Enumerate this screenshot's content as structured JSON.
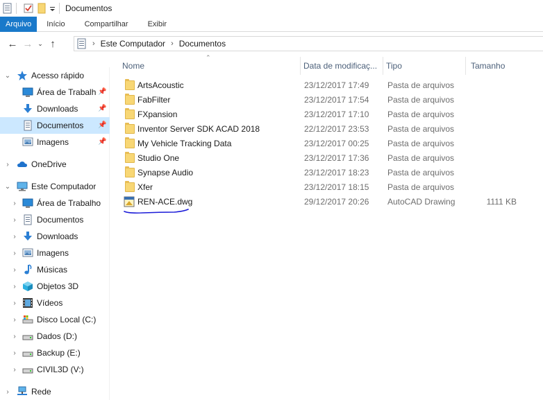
{
  "window": {
    "title": "Documentos"
  },
  "ribbon": {
    "tabs": [
      {
        "label": "Arquivo",
        "active": true
      },
      {
        "label": "Início",
        "active": false
      },
      {
        "label": "Compartilhar",
        "active": false
      },
      {
        "label": "Exibir",
        "active": false
      }
    ]
  },
  "address": {
    "crumbs": [
      "Este Computador",
      "Documentos"
    ]
  },
  "nav": {
    "quick_access": {
      "label": "Acesso rápido",
      "items": [
        {
          "label": "Área de Trabalho",
          "icon": "desktop-icon",
          "pinned": true
        },
        {
          "label": "Downloads",
          "icon": "downloads-icon",
          "pinned": true
        },
        {
          "label": "Documentos",
          "icon": "documents-icon",
          "pinned": true,
          "selected": true
        },
        {
          "label": "Imagens",
          "icon": "pictures-icon",
          "pinned": true
        }
      ]
    },
    "onedrive": {
      "label": "OneDrive"
    },
    "this_pc": {
      "label": "Este Computador",
      "items": [
        {
          "label": "Área de Trabalho",
          "icon": "desktop-icon"
        },
        {
          "label": "Documentos",
          "icon": "documents-icon"
        },
        {
          "label": "Downloads",
          "icon": "downloads-icon"
        },
        {
          "label": "Imagens",
          "icon": "pictures-icon"
        },
        {
          "label": "Músicas",
          "icon": "music-icon"
        },
        {
          "label": "Objetos 3D",
          "icon": "objects-3d-icon"
        },
        {
          "label": "Vídeos",
          "icon": "videos-icon"
        },
        {
          "label": "Disco Local (C:)",
          "icon": "local-disk-icon"
        },
        {
          "label": "Dados (D:)",
          "icon": "drive-icon"
        },
        {
          "label": "Backup (E:)",
          "icon": "drive-icon"
        },
        {
          "label": "CIVIL3D (V:)",
          "icon": "drive-icon"
        }
      ]
    },
    "network": {
      "label": "Rede"
    }
  },
  "columns": {
    "name": "Nome",
    "date": "Data de modificaç...",
    "type": "Tipo",
    "size": "Tamanho"
  },
  "files": [
    {
      "name": "ArtsAcoustic",
      "date": "23/12/2017 17:49",
      "type": "Pasta de arquivos",
      "size": "",
      "icon": "folder-icon"
    },
    {
      "name": "FabFilter",
      "date": "23/12/2017 17:54",
      "type": "Pasta de arquivos",
      "size": "",
      "icon": "folder-icon"
    },
    {
      "name": "FXpansion",
      "date": "23/12/2017 17:10",
      "type": "Pasta de arquivos",
      "size": "",
      "icon": "folder-icon"
    },
    {
      "name": "Inventor Server SDK ACAD 2018",
      "date": "22/12/2017 23:53",
      "type": "Pasta de arquivos",
      "size": "",
      "icon": "folder-icon"
    },
    {
      "name": "My Vehicle Tracking Data",
      "date": "23/12/2017 00:25",
      "type": "Pasta de arquivos",
      "size": "",
      "icon": "folder-icon"
    },
    {
      "name": "Studio One",
      "date": "23/12/2017 17:36",
      "type": "Pasta de arquivos",
      "size": "",
      "icon": "folder-icon"
    },
    {
      "name": "Synapse Audio",
      "date": "23/12/2017 18:23",
      "type": "Pasta de arquivos",
      "size": "",
      "icon": "folder-icon"
    },
    {
      "name": "Xfer",
      "date": "23/12/2017 18:15",
      "type": "Pasta de arquivos",
      "size": "",
      "icon": "folder-icon"
    },
    {
      "name": "REN-ACE.dwg",
      "date": "29/12/2017 20:26",
      "type": "AutoCAD Drawing",
      "size": "1111 KB",
      "icon": "dwg-file-icon"
    }
  ],
  "colors": {
    "accent": "#1979ca",
    "selection": "#cce8ff",
    "header_text": "#4c607a",
    "annotation": "#1a1ad8"
  }
}
